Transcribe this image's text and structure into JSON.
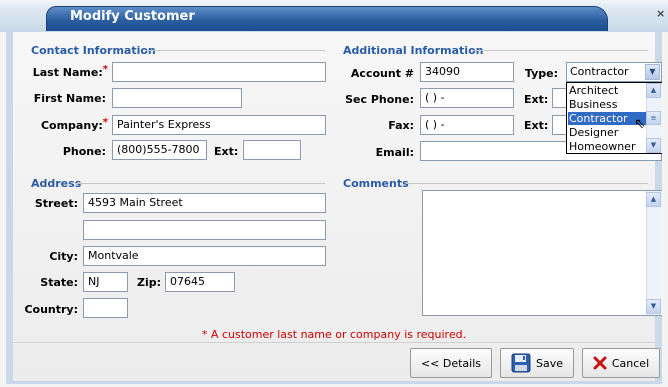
{
  "window": {
    "title": "Modify Customer",
    "close_glyph": "×"
  },
  "contact": {
    "heading": "Contact Information",
    "last_name": {
      "label": "Last Name:",
      "required_mark": "*",
      "value": ""
    },
    "first_name": {
      "label": "First Name:",
      "value": ""
    },
    "company": {
      "label": "Company:",
      "required_mark": "*",
      "value": "Painter's Express"
    },
    "phone": {
      "label": "Phone:",
      "value": "(800)555-7800",
      "ext_label": "Ext:",
      "ext_value": ""
    }
  },
  "additional": {
    "heading": "Additional Information",
    "account": {
      "label": "Account #",
      "value": "34090"
    },
    "type": {
      "label": "Type:",
      "selected": "Contractor",
      "options": [
        "Architect",
        "Business",
        "Contractor",
        "Designer",
        "Homeowner"
      ]
    },
    "sec_phone": {
      "label": "Sec Phone:",
      "value": "(  )  -",
      "ext_label": "Ext:"
    },
    "fax": {
      "label": "Fax:",
      "value": "(  )  -",
      "ext_label": "Ext:"
    },
    "email": {
      "label": "Email:",
      "value": ""
    }
  },
  "address": {
    "heading": "Address",
    "street": {
      "label": "Street:",
      "value": "4593 Main Street",
      "value2": ""
    },
    "city": {
      "label": "City:",
      "value": "Montvale"
    },
    "state": {
      "label": "State:",
      "value": "NJ"
    },
    "zip": {
      "label": "Zip:",
      "value": "07645"
    },
    "country": {
      "label": "Country:",
      "value": ""
    }
  },
  "comments": {
    "heading": "Comments",
    "value": ""
  },
  "footer": {
    "message": "* A customer last name or company is required.",
    "details_label": "<< Details",
    "save_label": "Save",
    "cancel_label": "Cancel"
  },
  "colors": {
    "accent": "#2a5ba5",
    "required": "#d00000",
    "title_bar": "#2b5fa0",
    "selection": "#316ac5"
  },
  "icons": {
    "save": "floppy-disk-icon",
    "cancel": "red-x-icon",
    "dropdown": "chevron-down-icon"
  }
}
